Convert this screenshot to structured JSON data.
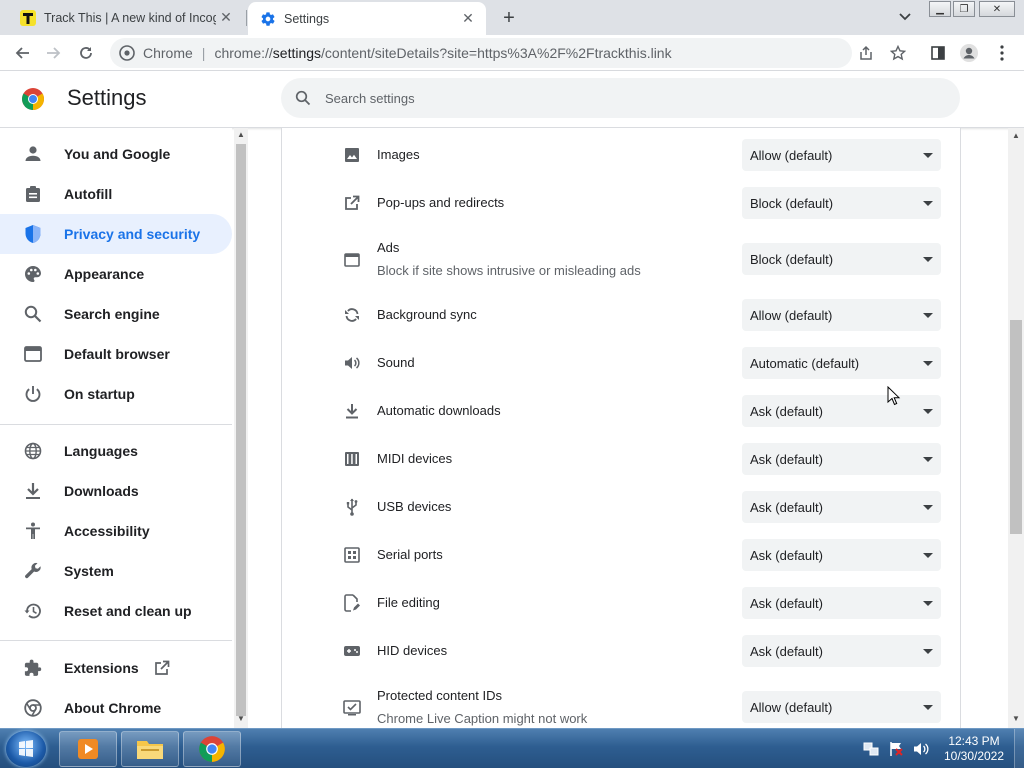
{
  "browser": {
    "tabs": [
      {
        "title": "Track This | A new kind of Incogn",
        "active": false
      },
      {
        "title": "Settings",
        "active": true
      }
    ],
    "omnibox": {
      "chrome_label": "Chrome",
      "separator": "|",
      "url_prefix": "chrome://",
      "url_host": "settings",
      "url_rest": "/content/siteDetails?site=https%3A%2F%2Ftrackthis.link"
    }
  },
  "settings_header": {
    "title": "Settings",
    "search_placeholder": "Search settings"
  },
  "sidebar": {
    "items": [
      {
        "label": "You and Google",
        "icon": "person-icon"
      },
      {
        "label": "Autofill",
        "icon": "clipboard-icon"
      },
      {
        "label": "Privacy and security",
        "icon": "shield-icon",
        "active": true
      },
      {
        "label": "Appearance",
        "icon": "palette-icon"
      },
      {
        "label": "Search engine",
        "icon": "search-icon"
      },
      {
        "label": "Default browser",
        "icon": "browser-window-icon"
      },
      {
        "label": "On startup",
        "icon": "power-icon"
      },
      {
        "label": "Languages",
        "icon": "globe-icon"
      },
      {
        "label": "Downloads",
        "icon": "download-icon"
      },
      {
        "label": "Accessibility",
        "icon": "accessibility-icon"
      },
      {
        "label": "System",
        "icon": "wrench-icon"
      },
      {
        "label": "Reset and clean up",
        "icon": "history-icon"
      },
      {
        "label": "Extensions",
        "icon": "puzzle-icon"
      },
      {
        "label": "About Chrome",
        "icon": "chrome-icon"
      }
    ]
  },
  "permissions": [
    {
      "label": "Images",
      "sub": "",
      "value": "Allow (default)",
      "icon": "image-icon"
    },
    {
      "label": "Pop-ups and redirects",
      "sub": "",
      "value": "Block (default)",
      "icon": "open-external-icon"
    },
    {
      "label": "Ads",
      "sub": "Block if site shows intrusive or misleading ads",
      "value": "Block (default)",
      "icon": "ads-window-icon"
    },
    {
      "label": "Background sync",
      "sub": "",
      "value": "Allow (default)",
      "icon": "sync-icon"
    },
    {
      "label": "Sound",
      "sub": "",
      "value": "Automatic (default)",
      "icon": "speaker-icon"
    },
    {
      "label": "Automatic downloads",
      "sub": "",
      "value": "Ask (default)",
      "icon": "download-icon"
    },
    {
      "label": "MIDI devices",
      "sub": "",
      "value": "Ask (default)",
      "icon": "piano-icon"
    },
    {
      "label": "USB devices",
      "sub": "",
      "value": "Ask (default)",
      "icon": "usb-icon"
    },
    {
      "label": "Serial ports",
      "sub": "",
      "value": "Ask (default)",
      "icon": "serial-port-icon"
    },
    {
      "label": "File editing",
      "sub": "",
      "value": "Ask (default)",
      "icon": "file-edit-icon"
    },
    {
      "label": "HID devices",
      "sub": "",
      "value": "Ask (default)",
      "icon": "gamepad-icon"
    },
    {
      "label": "Protected content IDs",
      "sub": "Chrome Live Caption might not work",
      "value": "Allow (default)",
      "icon": "protected-content-icon"
    }
  ],
  "taskbar": {
    "clock_time": "12:43 PM",
    "clock_date": "10/30/2022"
  },
  "colors": {
    "accent": "#1a73e8",
    "active_nav_bg": "#e8f0fe",
    "taskbar": "#2e5e91"
  }
}
